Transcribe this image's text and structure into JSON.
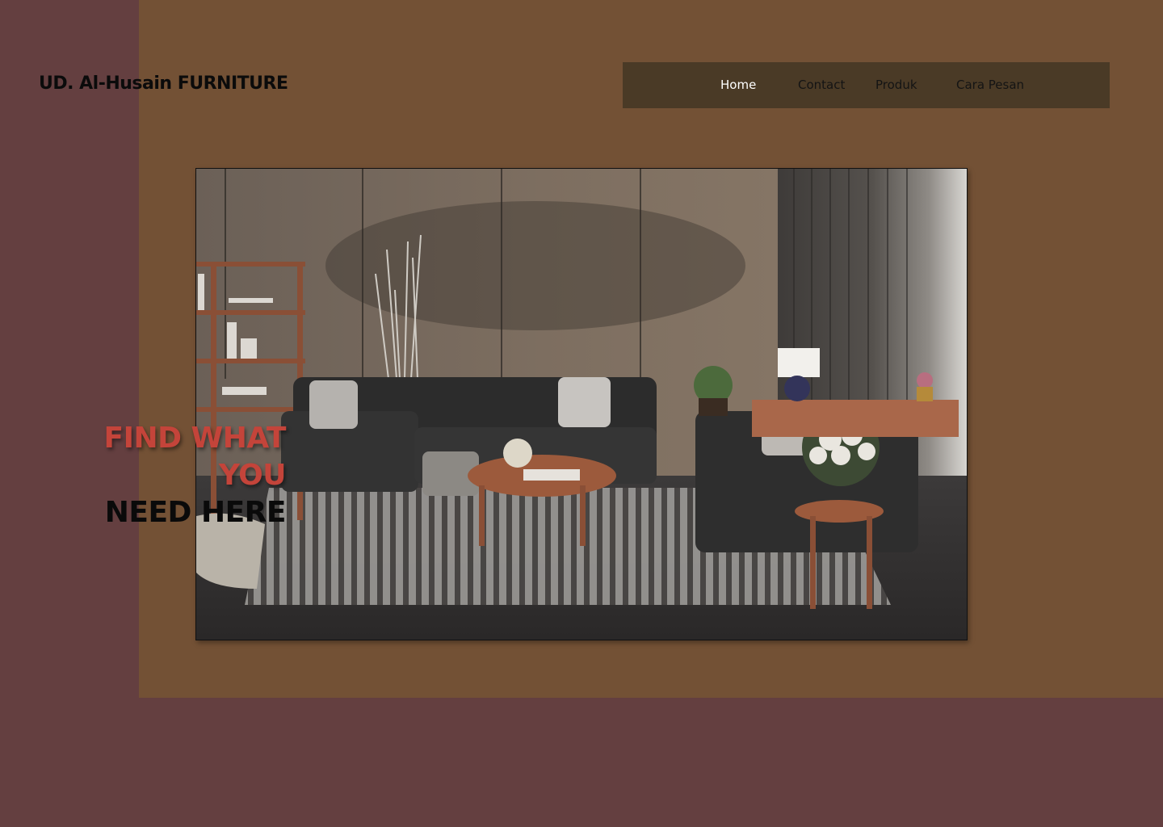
{
  "brand": {
    "name": "UD. Al-Husain FURNITURE"
  },
  "nav": {
    "items": [
      {
        "label": "Home",
        "active": true
      },
      {
        "label": "Contact",
        "active": false
      },
      {
        "label": "Produk",
        "active": false
      },
      {
        "label": "Cara Pesan",
        "active": false
      }
    ]
  },
  "hero": {
    "headline_line1": "FIND WHAT",
    "headline_line2": "YOU",
    "headline_line3": "NEED HERE",
    "image_icon": "living-room-photo"
  },
  "colors": {
    "background": "#643f40",
    "panel": "#735135",
    "nav_bar": "#4a3a26",
    "accent_red": "#c4443a",
    "nav_active_text": "#ffffff"
  }
}
